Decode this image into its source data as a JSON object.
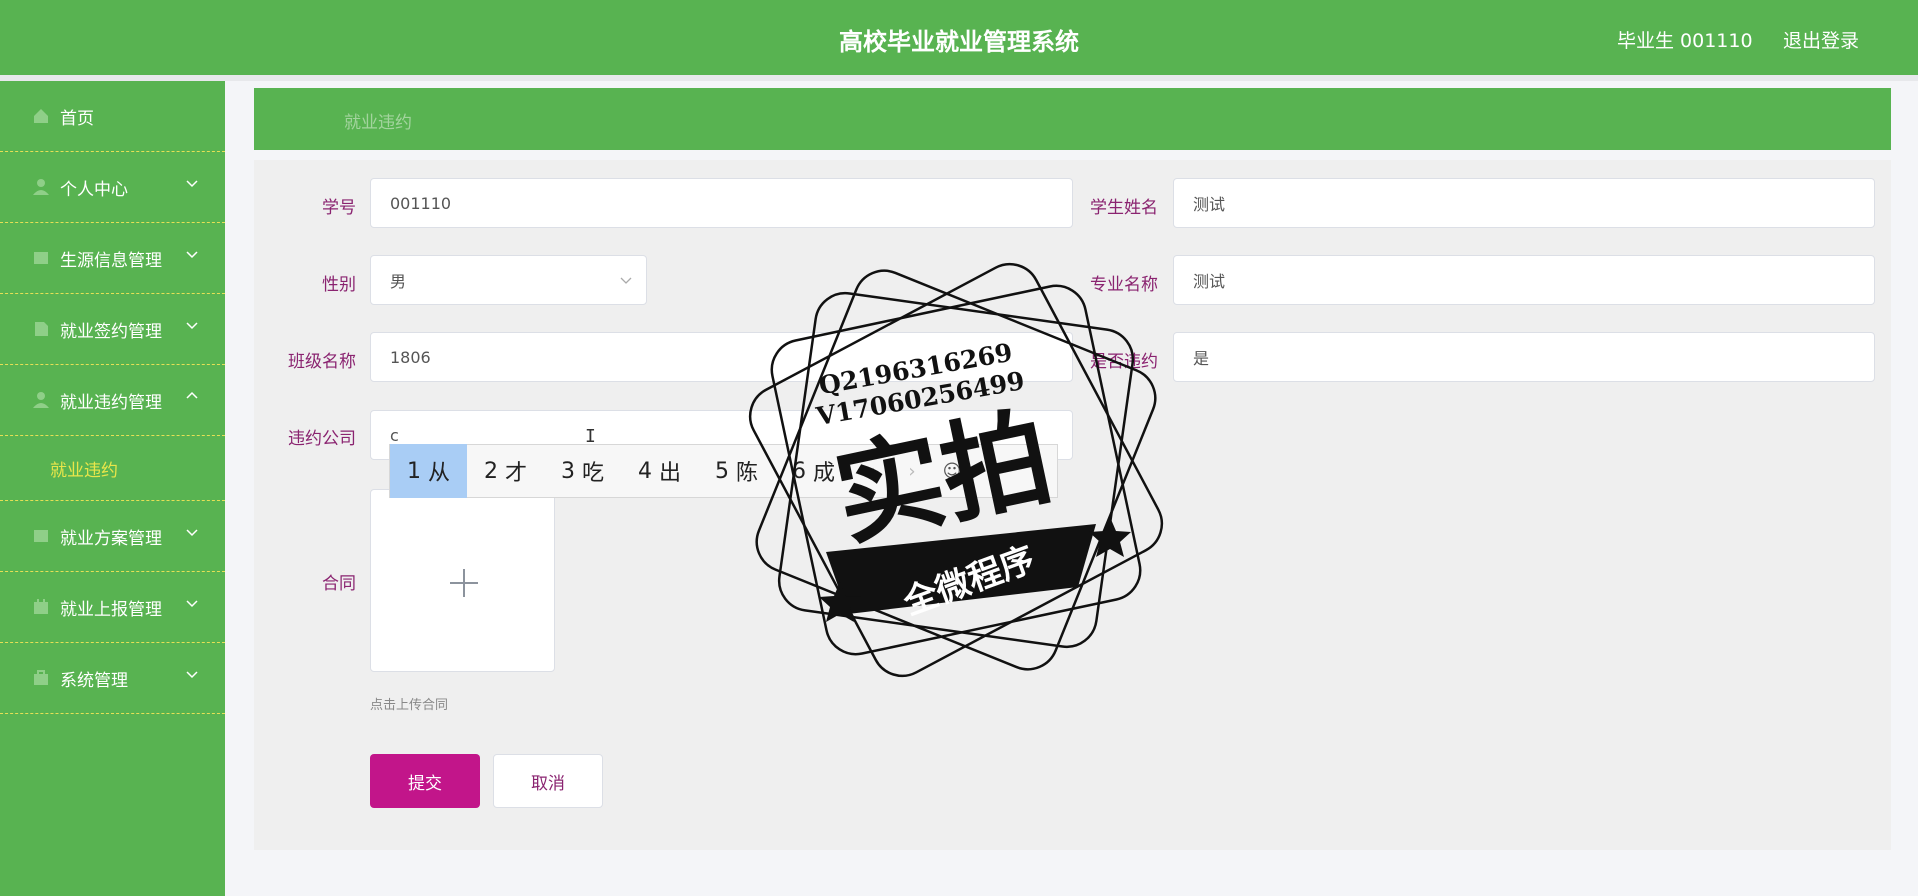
{
  "app": {
    "title": "高校毕业就业管理系统",
    "user": "毕业生 001110",
    "logout": "退出登录"
  },
  "sidebar": {
    "items": [
      {
        "label": "首页",
        "icon": "home-icon",
        "expandable": false
      },
      {
        "label": "个人中心",
        "icon": "user-icon",
        "expandable": true
      },
      {
        "label": "生源信息管理",
        "icon": "grid-icon",
        "expandable": true
      },
      {
        "label": "就业签约管理",
        "icon": "document-icon",
        "expandable": true
      },
      {
        "label": "就业违约管理",
        "icon": "user-icon",
        "expandable": true,
        "expanded": true
      },
      {
        "label": "就业方案管理",
        "icon": "grid-icon",
        "expandable": true
      },
      {
        "label": "就业上报管理",
        "icon": "calendar-icon",
        "expandable": true
      },
      {
        "label": "系统管理",
        "icon": "briefcase-icon",
        "expandable": true
      }
    ],
    "submenu": {
      "label": "就业违约"
    }
  },
  "breadcrumb": "就业违约",
  "form": {
    "student_id": {
      "label": "学号",
      "value": "001110"
    },
    "student_name": {
      "label": "学生姓名",
      "value": "测试"
    },
    "gender": {
      "label": "性别",
      "value": "男"
    },
    "major": {
      "label": "专业名称",
      "value": "测试"
    },
    "class_name": {
      "label": "班级名称",
      "value": "1806"
    },
    "breached": {
      "label": "是否违约",
      "value": "是"
    },
    "company": {
      "label": "违约公司",
      "value": "c"
    },
    "contract": {
      "label": "合同",
      "hint": "点击上传合同"
    },
    "submit": "提交",
    "cancel": "取消"
  },
  "ime": {
    "candidates": [
      {
        "num": "1",
        "char": "从"
      },
      {
        "num": "2",
        "char": "才"
      },
      {
        "num": "3",
        "char": "吃"
      },
      {
        "num": "4",
        "char": "出"
      },
      {
        "num": "5",
        "char": "陈"
      },
      {
        "num": "6",
        "char": "成"
      }
    ],
    "prev": "‹",
    "next": "›",
    "emoji": "☺"
  },
  "watermark": {
    "contact1": "Q2196316269",
    "contact2": "V17060256499",
    "main": "实拍",
    "banner": "全微程序"
  },
  "colors": {
    "primary_green": "#58b351",
    "accent_magenta": "#c2158a",
    "label_color": "#8a2370",
    "submenu_yellow": "#e9e64a"
  }
}
